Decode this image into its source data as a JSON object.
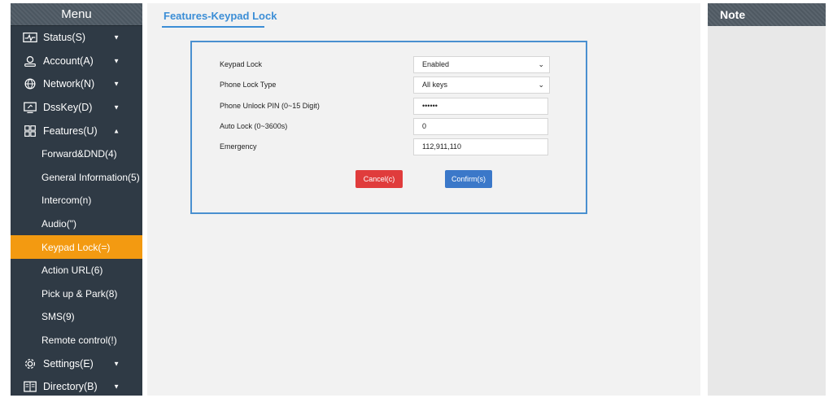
{
  "sidebar": {
    "header": "Menu",
    "top_items": [
      {
        "label": "Status(S)",
        "icon": "status-icon"
      },
      {
        "label": "Account(A)",
        "icon": "account-icon"
      },
      {
        "label": "Network(N)",
        "icon": "network-icon"
      },
      {
        "label": "DssKey(D)",
        "icon": "dsskey-icon"
      },
      {
        "label": "Features(U)",
        "icon": "features-icon"
      }
    ],
    "sub_items": [
      {
        "label": "Forward&DND(4)"
      },
      {
        "label": "General Information(5)"
      },
      {
        "label": "Intercom(n)"
      },
      {
        "label": "Audio(\")"
      },
      {
        "label": "Keypad Lock(=)",
        "active": true
      },
      {
        "label": "Action URL(6)"
      },
      {
        "label": "Pick up & Park(8)"
      },
      {
        "label": "SMS(9)"
      },
      {
        "label": "Remote control(!)"
      }
    ],
    "bottom_items": [
      {
        "label": "Settings(E)",
        "icon": "settings-icon"
      },
      {
        "label": "Directory(B)",
        "icon": "directory-icon"
      }
    ]
  },
  "main": {
    "title": "Features-Keypad Lock",
    "fields": [
      {
        "label": "Keypad Lock",
        "value": "Enabled",
        "type": "select"
      },
      {
        "label": "Phone Lock Type",
        "value": "All keys",
        "type": "select"
      },
      {
        "label": "Phone Unlock PIN (0~15 Digit)",
        "value": "••••••",
        "type": "password"
      },
      {
        "label": "Auto Lock (0~3600s)",
        "value": "0",
        "type": "text"
      },
      {
        "label": "Emergency",
        "value": "112,911,110",
        "type": "text"
      }
    ],
    "cancel_label": "Cancel(c)",
    "confirm_label": "Confirm(s)"
  },
  "note": {
    "header": "Note"
  },
  "colors": {
    "sidebar_bg": "#2f3a45",
    "active_item": "#f39a11",
    "accent_blue": "#3c8ed6",
    "cancel_red": "#e03c3c",
    "confirm_blue": "#3b78c9"
  }
}
